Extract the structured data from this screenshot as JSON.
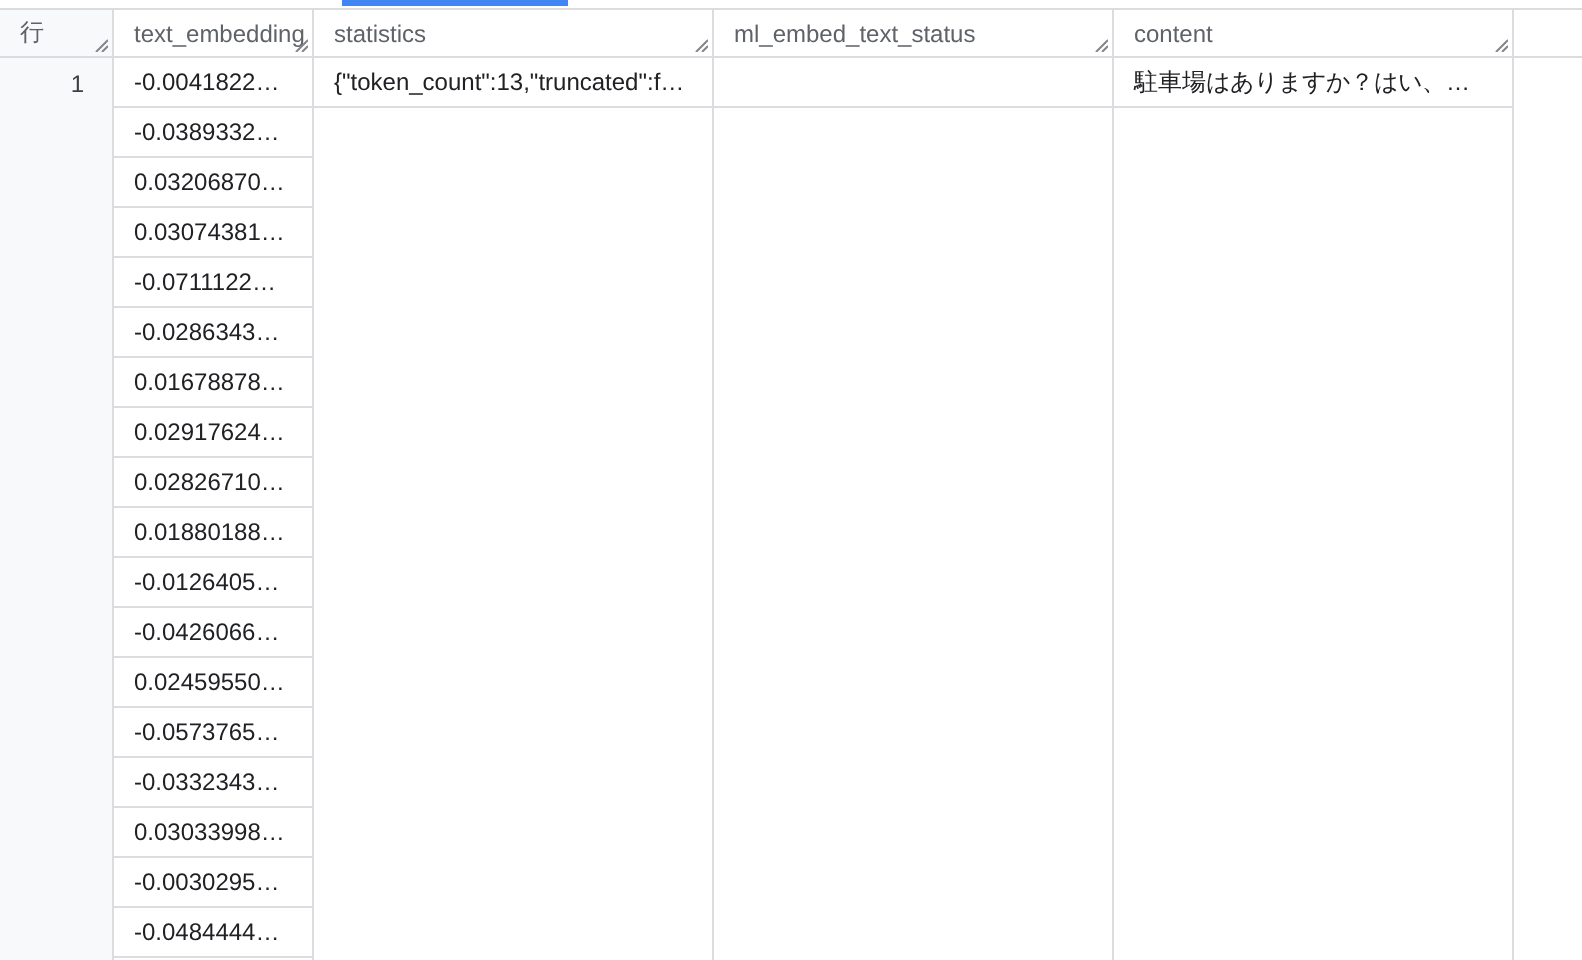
{
  "columns": [
    {
      "label": "行"
    },
    {
      "label": "text_embedding"
    },
    {
      "label": "statistics"
    },
    {
      "label": "ml_embed_text_status"
    },
    {
      "label": "content"
    }
  ],
  "rows": [
    {
      "number": "1",
      "statistics": "{\"token_count\":13,\"truncated\":f…",
      "content": "駐車場はありますか？はい、…",
      "text_embedding": [
        "-0.0041822…",
        "-0.0389332…",
        "0.03206870…",
        "0.03074381…",
        "-0.0711122…",
        "-0.0286343…",
        "0.01678878…",
        "0.02917624…",
        "0.02826710…",
        "0.01880188…",
        "-0.0126405…",
        "-0.0426066…",
        "0.02459550…",
        "-0.0573765…",
        "-0.0332343…",
        "0.03033998…",
        "-0.0030295…",
        "-0.0484444…"
      ]
    }
  ]
}
